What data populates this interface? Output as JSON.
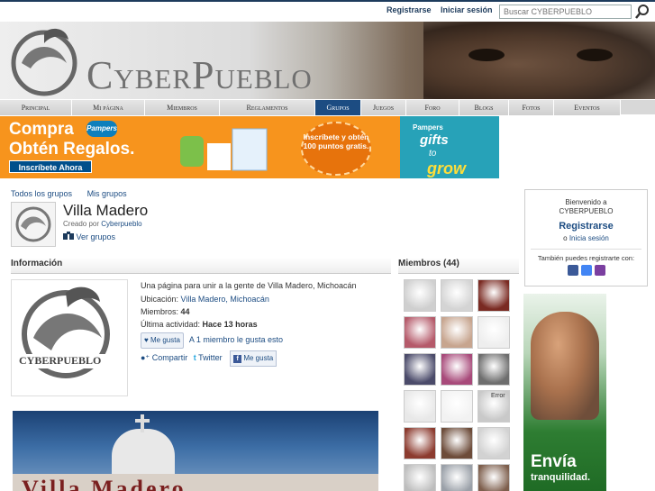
{
  "topbar": {
    "register_label": "Registrarse",
    "login_label": "Iniciar sesión",
    "search_placeholder": "Buscar CYBERPUEBLO",
    "search_icon": "magnifier-icon"
  },
  "banner": {
    "logo_text": "CyberPueblo"
  },
  "nav": {
    "tabs": [
      {
        "label": "Principal",
        "active": false
      },
      {
        "label": "Mi página",
        "active": false
      },
      {
        "label": "Miembros",
        "active": false
      },
      {
        "label": "Reglamentos",
        "active": false
      },
      {
        "label": "Grupos",
        "active": true
      },
      {
        "label": "Juegos",
        "active": false
      },
      {
        "label": "Foro",
        "active": false
      },
      {
        "label": "Blogs",
        "active": false
      },
      {
        "label": "Fotos",
        "active": false
      },
      {
        "label": "Eventos",
        "active": false
      }
    ]
  },
  "ad_banner": {
    "line1": "Compra",
    "brand": "Pampers",
    "line2": "Obtén Regalos.",
    "cta": "Inscríbete Ahora",
    "burst_text": "Inscríbete y obtén 100 puntos gratis.",
    "right_brand": "Pampers",
    "right_gifts": "gifts",
    "right_to": "to",
    "right_grow": "grow"
  },
  "subnav": {
    "all_groups": "Todos los grupos",
    "my_groups": "Mis grupos"
  },
  "group": {
    "title": "Villa Madero",
    "created_by_label": "Creado por",
    "creator": "Cyberpueblo",
    "view_groups": "Ver grupos"
  },
  "info_section": {
    "heading": "Información",
    "description": "Una página para unir a la gente de Villa Madero, Michoacán",
    "location_label": "Ubicación:",
    "location_value": "Villa Madero, Michoacán",
    "members_label": "Miembros:",
    "members_value": "44",
    "last_activity_label": "Última actividad:",
    "last_activity_value": "Hace 13 horas",
    "like_button": "Me gusta",
    "like_count_text": "A 1 miembro le gusta esto",
    "share_label": "Compartir",
    "twitter_label": "Twitter",
    "fb_like_label": "Me gusta",
    "logo_caption": "CYBERPUEBLO"
  },
  "members_section": {
    "heading": "Miembros (44)",
    "avatar_colors": [
      "#cfcfcf",
      "#d4d4d4",
      "#7a2a22",
      "#b55a6a",
      "#c7a58f",
      "#eeeeee",
      "#4b4b6a",
      "#a84a7a",
      "#6e6e6e",
      "#e8e8e8",
      "#f2f2f2",
      "#c9c9c9",
      "#8c3b2f",
      "#6d4c3a",
      "#d2d2d2",
      "#bdbdbd",
      "#9aa0a8",
      "#7d5e4c"
    ],
    "error_text": "Error"
  },
  "welcome_box": {
    "greeting_line1": "Bienvenido a",
    "greeting_line2": "CYBERPUEBLO",
    "register_label": "Registrarse",
    "or_text": "o",
    "login_label": "Inicia sesión",
    "also_text": "También puedes registrarte con:"
  },
  "side_ad": {
    "headline": "Envía",
    "subline": "tranquilidad."
  },
  "photo": {
    "caption_text": "Villa Madero"
  },
  "colors": {
    "brand_blue": "#1c4c82",
    "nav_active": "#1c4c82",
    "ad_orange": "#f7941d",
    "ad_teal": "#27a2b8",
    "side_ad_green": "#2e7d32"
  }
}
